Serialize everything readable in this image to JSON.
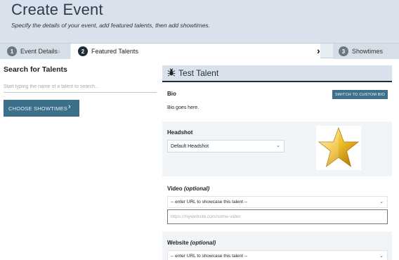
{
  "header": {
    "title": "Create Event",
    "subtitle": "Specify the details of your event, add featured talents, then add showtimes."
  },
  "steps": [
    {
      "num": "1",
      "label": "Event Details"
    },
    {
      "num": "2",
      "label": "Featured Talents"
    },
    {
      "num": "3",
      "label": "Showtimes"
    }
  ],
  "search": {
    "heading": "Search for Talents",
    "placeholder": "Start typing the name of a talent to search...",
    "button_label": "CHOOSE SHOWTIMES",
    "button_icon": "chevron-right-icon"
  },
  "talent": {
    "name": "Test Talent",
    "icon": "bug-icon",
    "bio_label": "Bio",
    "bio_switch_label": "SWITCH TO CUSTOM BIO",
    "bio_text": "Bio goes here.",
    "headshot_label": "Headshot",
    "headshot_selected": "Default Headshot",
    "headshot_image": "star-icon",
    "video_label": "Video",
    "video_optional": "(optional)",
    "video_select": "-- enter URL to showcase this talent --",
    "video_placeholder": "https://mywebsite.com/some-video",
    "website_label": "Website",
    "website_optional": "(optional)",
    "website_select": "-- enter URL to showcase this talent --"
  },
  "colors": {
    "header_bg": "#d9e2ec",
    "accent": "#3b6f8a",
    "dark": "#1f2b37"
  }
}
